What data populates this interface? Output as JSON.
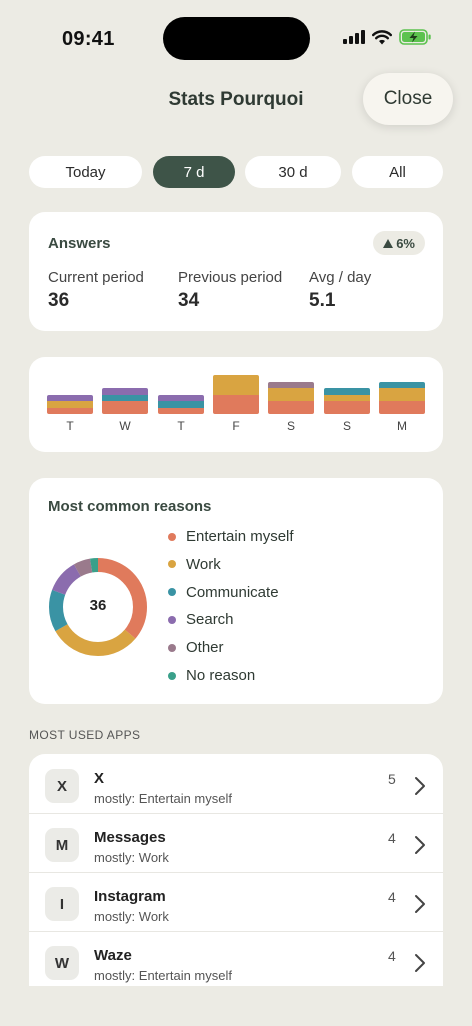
{
  "status_bar": {
    "time": "09:41"
  },
  "header": {
    "title": "Stats Pourquoi",
    "close_label": "Close"
  },
  "period_tabs": [
    {
      "label": "Today",
      "active": false
    },
    {
      "label": "7 d",
      "active": true
    },
    {
      "label": "30 d",
      "active": false
    },
    {
      "label": "All",
      "active": false
    }
  ],
  "answers": {
    "title": "Answers",
    "trend": "6%",
    "trend_direction": "up",
    "stats": [
      {
        "label": "Current period",
        "value": "36"
      },
      {
        "label": "Previous period",
        "value": "34"
      },
      {
        "label": "Avg / day",
        "value": "5.1"
      }
    ]
  },
  "weekly": {
    "days": [
      {
        "label": "T",
        "counts": {
          "entertain": 1,
          "work": 1,
          "communicate": 0,
          "search": 1,
          "other": 0,
          "no_reason": 0
        }
      },
      {
        "label": "W",
        "counts": {
          "entertain": 2,
          "work": 0,
          "communicate": 1,
          "search": 1,
          "other": 0,
          "no_reason": 0
        }
      },
      {
        "label": "T",
        "counts": {
          "entertain": 1,
          "work": 0,
          "communicate": 1,
          "search": 1,
          "other": 0,
          "no_reason": 0
        }
      },
      {
        "label": "F",
        "counts": {
          "entertain": 3,
          "work": 3,
          "communicate": 0,
          "search": 0,
          "other": 0,
          "no_reason": 0
        }
      },
      {
        "label": "S",
        "counts": {
          "entertain": 2,
          "work": 2,
          "communicate": 0,
          "search": 0,
          "other": 1,
          "no_reason": 0
        }
      },
      {
        "label": "S",
        "counts": {
          "entertain": 2,
          "work": 1,
          "communicate": 1,
          "search": 0,
          "other": 0,
          "no_reason": 0
        }
      },
      {
        "label": "M",
        "counts": {
          "entertain": 2,
          "work": 2,
          "communicate": 1,
          "search": 0,
          "other": 0,
          "no_reason": 0
        }
      }
    ]
  },
  "reasons": {
    "title": "Most common reasons",
    "total": "36",
    "items": [
      {
        "key": "entertain",
        "label": "Entertain myself",
        "color": "#e07a5c",
        "count": 13
      },
      {
        "key": "work",
        "label": "Work",
        "color": "#d9a441",
        "count": 11
      },
      {
        "key": "communicate",
        "label": "Communicate",
        "color": "#3a93a4",
        "count": 5
      },
      {
        "key": "search",
        "label": "Search",
        "color": "#8b6cae",
        "count": 4
      },
      {
        "key": "other",
        "label": "Other",
        "color": "#9a7a8c",
        "count": 2
      },
      {
        "key": "no_reason",
        "label": "No reason",
        "color": "#3aa08a",
        "count": 1
      }
    ]
  },
  "apps": {
    "section_label": "MOST USED APPS",
    "items": [
      {
        "initial": "X",
        "name": "X",
        "subtitle": "mostly: Entertain myself",
        "count": "5"
      },
      {
        "initial": "M",
        "name": "Messages",
        "subtitle": "mostly: Work",
        "count": "4"
      },
      {
        "initial": "I",
        "name": "Instagram",
        "subtitle": "mostly: Work",
        "count": "4"
      },
      {
        "initial": "W",
        "name": "Waze",
        "subtitle": "mostly: Entertain myself",
        "count": "4"
      }
    ]
  }
}
